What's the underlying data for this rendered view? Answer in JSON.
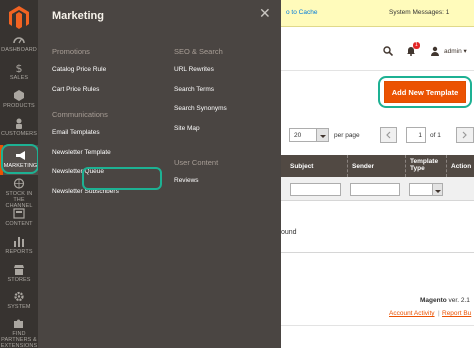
{
  "nav": {
    "items": [
      {
        "label": "DASHBOARD",
        "icon": "dashboard-icon"
      },
      {
        "label": "SALES",
        "icon": "dollar-icon"
      },
      {
        "label": "PRODUCTS",
        "icon": "cube-icon"
      },
      {
        "label": "CUSTOMERS",
        "icon": "person-icon"
      },
      {
        "label": "MARKETING",
        "icon": "megaphone-icon"
      },
      {
        "label": "STOCK IN THE CHANNEL",
        "icon": "globe-icon"
      },
      {
        "label": "CONTENT",
        "icon": "content-icon"
      },
      {
        "label": "REPORTS",
        "icon": "bar-chart-icon"
      },
      {
        "label": "STORES",
        "icon": "store-icon"
      },
      {
        "label": "SYSTEM",
        "icon": "gear-icon"
      },
      {
        "label": "FIND PARTNERS & EXTENSIONS",
        "icon": "puzzle-icon"
      }
    ]
  },
  "panel": {
    "title": "Marketing",
    "promotions": {
      "heading": "Promotions",
      "links": [
        "Catalog Price Rule",
        "Cart Price Rules"
      ]
    },
    "communications": {
      "heading": "Communications",
      "links": [
        "Email Templates",
        "Newsletter Template",
        "Newsletter Queue",
        "Newsletter Subscribers"
      ]
    },
    "seo": {
      "heading": "SEO & Search",
      "links": [
        "URL Rewrites",
        "Search Terms",
        "Search Synonyms",
        "Site Map"
      ]
    },
    "user_content": {
      "heading": "User Content",
      "links": [
        "Reviews"
      ]
    }
  },
  "message_bar": {
    "link_fragment": "o to Cache",
    "system_messages": "System Messages: 1"
  },
  "header": {
    "admin": "admin ▾",
    "notification_count": "1"
  },
  "add_button": "Add New Template",
  "pager": {
    "per_page_value": "20",
    "per_page_label": "per page",
    "current_page": "1",
    "of_pages": "of 1"
  },
  "grid": {
    "columns": [
      "Subject",
      "Sender",
      "Template Type",
      "Action"
    ],
    "empty_fragment": "ound"
  },
  "footer": {
    "version_label": "Magento",
    "version_value": "ver. 2.1",
    "activity": "Account Activity",
    "separator": "|",
    "report": "Report Bu"
  },
  "colors": {
    "accent": "#eb5202",
    "highlight_ring": "#1db193",
    "nav_bg": "#373330",
    "panel_bg": "#4a4542"
  }
}
